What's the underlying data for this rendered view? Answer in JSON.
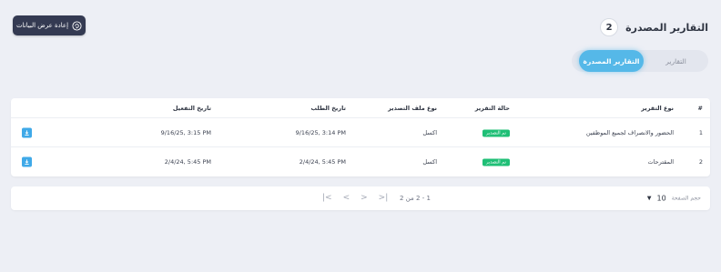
{
  "header": {
    "title": "التقارير المصدرة",
    "count": "2",
    "reload_label": "إعادة عرض البيانات",
    "reload_icon": "refresh-icon"
  },
  "tabs": [
    {
      "label": "التقارير",
      "active": false
    },
    {
      "label": "التقارير المصدرة",
      "active": true
    }
  ],
  "table": {
    "columns": {
      "num": "#",
      "type": "نوع التقرير",
      "status": "حالة التقرير",
      "file_type": "نوع ملف التصدير",
      "request_date": "تاريخ الطلب",
      "run_date": "تاريخ التفعيل"
    },
    "rows": [
      {
        "num": "1",
        "type": "الحضور والانصراف لجميع الموظفين",
        "status": "تم التصدير",
        "file_type": "اكسل",
        "request_date": "9/16/25, 3:14 PM",
        "run_date": "9/16/25, 3:15 PM"
      },
      {
        "num": "2",
        "type": "المقترحات",
        "status": "تم التصدير",
        "file_type": "اكسل",
        "request_date": "2/4/24, 5:45 PM",
        "run_date": "2/4/24, 5:45 PM"
      }
    ],
    "download_icon": "download-icon",
    "status_color": "#1fbf76"
  },
  "pager": {
    "page_size_label": "حجم الصفحة",
    "page_size_value": "10",
    "range": "1 - 2 من 2",
    "first_icon": "first-page-icon",
    "prev_icon": "prev-page-icon",
    "next_icon": "next-page-icon",
    "last_icon": "last-page-icon"
  },
  "colors": {
    "accent": "#55b8e8",
    "dark_button": "#343a52",
    "background": "#edeff5"
  }
}
